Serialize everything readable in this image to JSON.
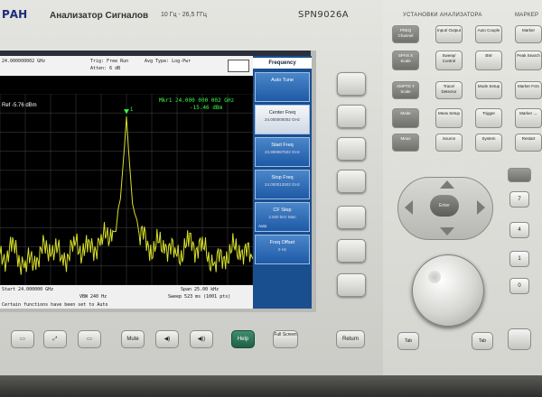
{
  "device": {
    "brand": "РАН",
    "title": "Анализатор Сигналов",
    "freq_range": "10 Гц - 26,5 ГГц",
    "model": "SPN9026A"
  },
  "screen": {
    "header": {
      "center": "24.000000002 GHz",
      "trig": "Trig: Free Run",
      "atten": "Atten: 6 dB",
      "avg": "Avg Type: Log-Pwr"
    },
    "ref_level": "Ref -5.76 dBm",
    "marker": {
      "label": "Mkr1 24.000 000 002 GHz",
      "value": "-15.46 dBm",
      "number": "1"
    },
    "footer": {
      "start": "Start 24.000000 GHz",
      "vbw": "VBW 240 Hz",
      "span": "Span 25.00 kHz",
      "sweep": "Sweep 523 ms (1001 pts)",
      "status": "Certain functions have been set to Auto"
    },
    "softkeys": {
      "title": "Frequency",
      "items": [
        {
          "label": "Auto Tune",
          "sub": ""
        },
        {
          "label": "Center Freq",
          "sub": "24.000000002 GHz"
        },
        {
          "label": "Start Freq",
          "sub": "23.999987502 GHz"
        },
        {
          "label": "Stop Freq",
          "sub": "24.000012502 GHz"
        },
        {
          "label": "CF Step",
          "sub": "2.500 kHz Man"
        },
        {
          "label": "Freq Offset",
          "sub": "0 Hz"
        }
      ],
      "cf_auto": "Auto"
    }
  },
  "chart_data": {
    "type": "line",
    "x": [
      -12.5,
      -11.25,
      -10,
      -8.75,
      -7.5,
      -6.25,
      -5,
      -3.75,
      -2.5,
      -1.25,
      -0.6,
      -0.2,
      0,
      0.2,
      0.6,
      1.25,
      2.5,
      3.75,
      5,
      6.25,
      7.5,
      8.75,
      10,
      11.25,
      12.5
    ],
    "series": [
      {
        "values": [
          -76,
          -71,
          -78,
          -73,
          -69,
          -75,
          -70,
          -72,
          -68,
          -62,
          -50,
          -28,
          -15.46,
          -29,
          -52,
          -64,
          -70,
          -68,
          -74,
          -69,
          -71,
          -77,
          -72,
          -70,
          -75
        ]
      }
    ],
    "xlabel": "",
    "ylabel": "",
    "grid": true
  },
  "bottom_buttons": {
    "mute": "Mute",
    "help": "Help",
    "full_screen": "Full Screen",
    "return": "Return",
    "tab_left": "Tab",
    "tab_right": "Tab"
  },
  "right_panel": {
    "section_title": "УСТАНОВКИ АНАЛИЗАТОРА",
    "section_title2": "МАРКЕР",
    "keys": [
      {
        "label": "FREQ Channel"
      },
      {
        "label": "Input/ Output"
      },
      {
        "label": "Auto Couple"
      },
      {
        "label": "Marker"
      },
      {
        "label": "SPAN X Scale"
      },
      {
        "label": "Sweep/ Control"
      },
      {
        "label": "BW"
      },
      {
        "label": "Peak Search"
      },
      {
        "label": "AMPTD Y Scale"
      },
      {
        "label": "Trace/ Detector"
      },
      {
        "label": "Mode Setup"
      },
      {
        "label": "Marker Fctn"
      },
      {
        "label": "Mode"
      },
      {
        "label": "Meas Setup"
      },
      {
        "label": "Trigger"
      },
      {
        "label": "Marker →"
      },
      {
        "label": "Meas"
      },
      {
        "label": "Source"
      },
      {
        "label": "System"
      },
      {
        "label": "Restart"
      }
    ],
    "numpad": [
      "7",
      "4",
      "1",
      "0"
    ],
    "enter": "Enter"
  },
  "colors": {
    "trace": "#d8df2a",
    "marker": "#39ff4a",
    "softkey": "#1e5aa6",
    "screen_bg": "#000000"
  }
}
